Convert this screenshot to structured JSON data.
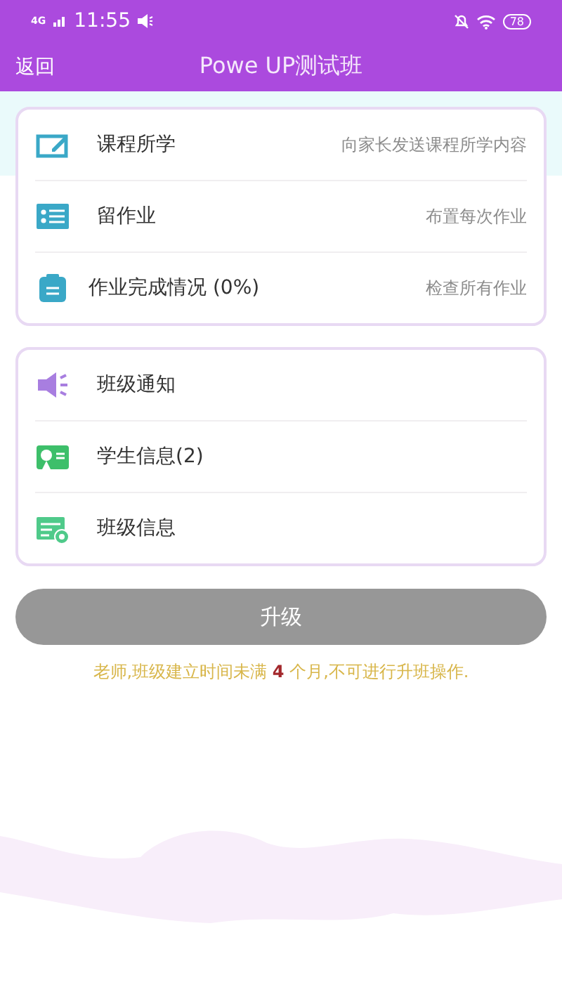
{
  "status_bar": {
    "network": "4G",
    "time": "11:55",
    "battery": "78"
  },
  "header": {
    "back": "返回",
    "title": "Powe UP测试班"
  },
  "cards": [
    {
      "items": [
        {
          "kind": "pencil",
          "label": "课程所学",
          "hint": "向家长发送课程所学内容"
        },
        {
          "kind": "list",
          "label": "留作业",
          "hint": "布置每次作业"
        },
        {
          "kind": "clipboard",
          "label": "作业完成情况 (0%)",
          "hint": "检查所有作业"
        }
      ]
    },
    {
      "items": [
        {
          "kind": "megaphone",
          "label": "班级通知"
        },
        {
          "kind": "student",
          "label": "学生信息(2)"
        },
        {
          "kind": "classinfo",
          "label": "班级信息"
        }
      ]
    }
  ],
  "upgrade_button": {
    "label": "升级",
    "disabled": true
  },
  "notice": "老师,班级建立时间未满 **4** 个月,不可进行升班操作."
}
